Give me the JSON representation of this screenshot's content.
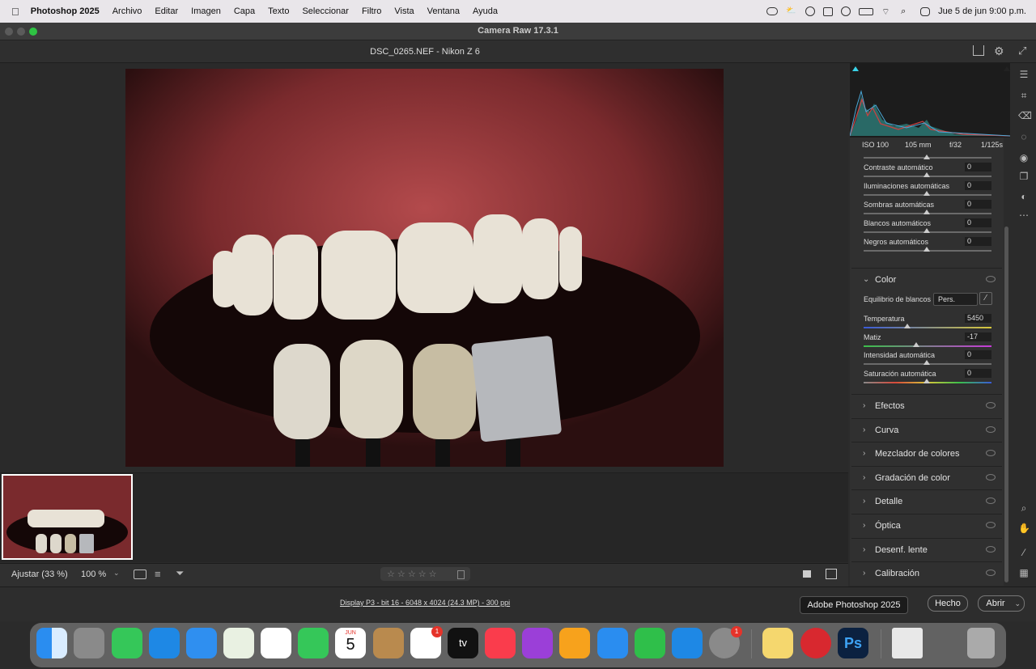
{
  "menubar": {
    "app_name": "Photoshop 2025",
    "items": [
      "Archivo",
      "Editar",
      "Imagen",
      "Capa",
      "Texto",
      "Seleccionar",
      "Filtro",
      "Vista",
      "Ventana",
      "Ayuda"
    ],
    "clock": "Jue 5 de jun  9:00 p.m."
  },
  "window": {
    "title": "Camera Raw 17.3.1"
  },
  "file": {
    "title": "DSC_0265.NEF -  Nikon Z 6"
  },
  "histogram": {
    "iso": "ISO 100",
    "focal": "105 mm",
    "aperture": "f/32",
    "shutter": "1/125s"
  },
  "basic_sliders": [
    {
      "label": "Contraste automático",
      "value": "0"
    },
    {
      "label": "Iluminaciones automáticas",
      "value": "0"
    },
    {
      "label": "Sombras automáticas",
      "value": "0"
    },
    {
      "label": "Blancos automáticos",
      "value": "0"
    },
    {
      "label": "Negros automáticos",
      "value": "0"
    }
  ],
  "color": {
    "title": "Color",
    "wb_label": "Equilibrio de blancos",
    "wb_value": "Pers.",
    "sliders": [
      {
        "label": "Temperatura",
        "value": "5450"
      },
      {
        "label": "Matiz",
        "value": "-17"
      },
      {
        "label": "Intensidad automática",
        "value": "0"
      },
      {
        "label": "Saturación automática",
        "value": "0"
      }
    ]
  },
  "sections": [
    "Efectos",
    "Curva",
    "Mezclador de colores",
    "Gradación de color",
    "Detalle",
    "Óptica",
    "Desenf. lente",
    "Calibración"
  ],
  "bottombar": {
    "fit": "Ajustar (33 %)",
    "zoom": "100 %",
    "stars": "☆ ☆ ☆ ☆ ☆"
  },
  "footer": {
    "info": "Display P3 - bit 16 - 6048 x 4024 (24.3 MP) - 300 ppi",
    "done": "Hecho",
    "open": "Abrir",
    "tooltip": "Adobe Photoshop 2025"
  },
  "dock": {
    "calendar_month": "JUN",
    "calendar_day": "5",
    "badge_reminders": "1",
    "badge_settings": "1",
    "tv_label": "tv",
    "ps_label": "Ps"
  }
}
